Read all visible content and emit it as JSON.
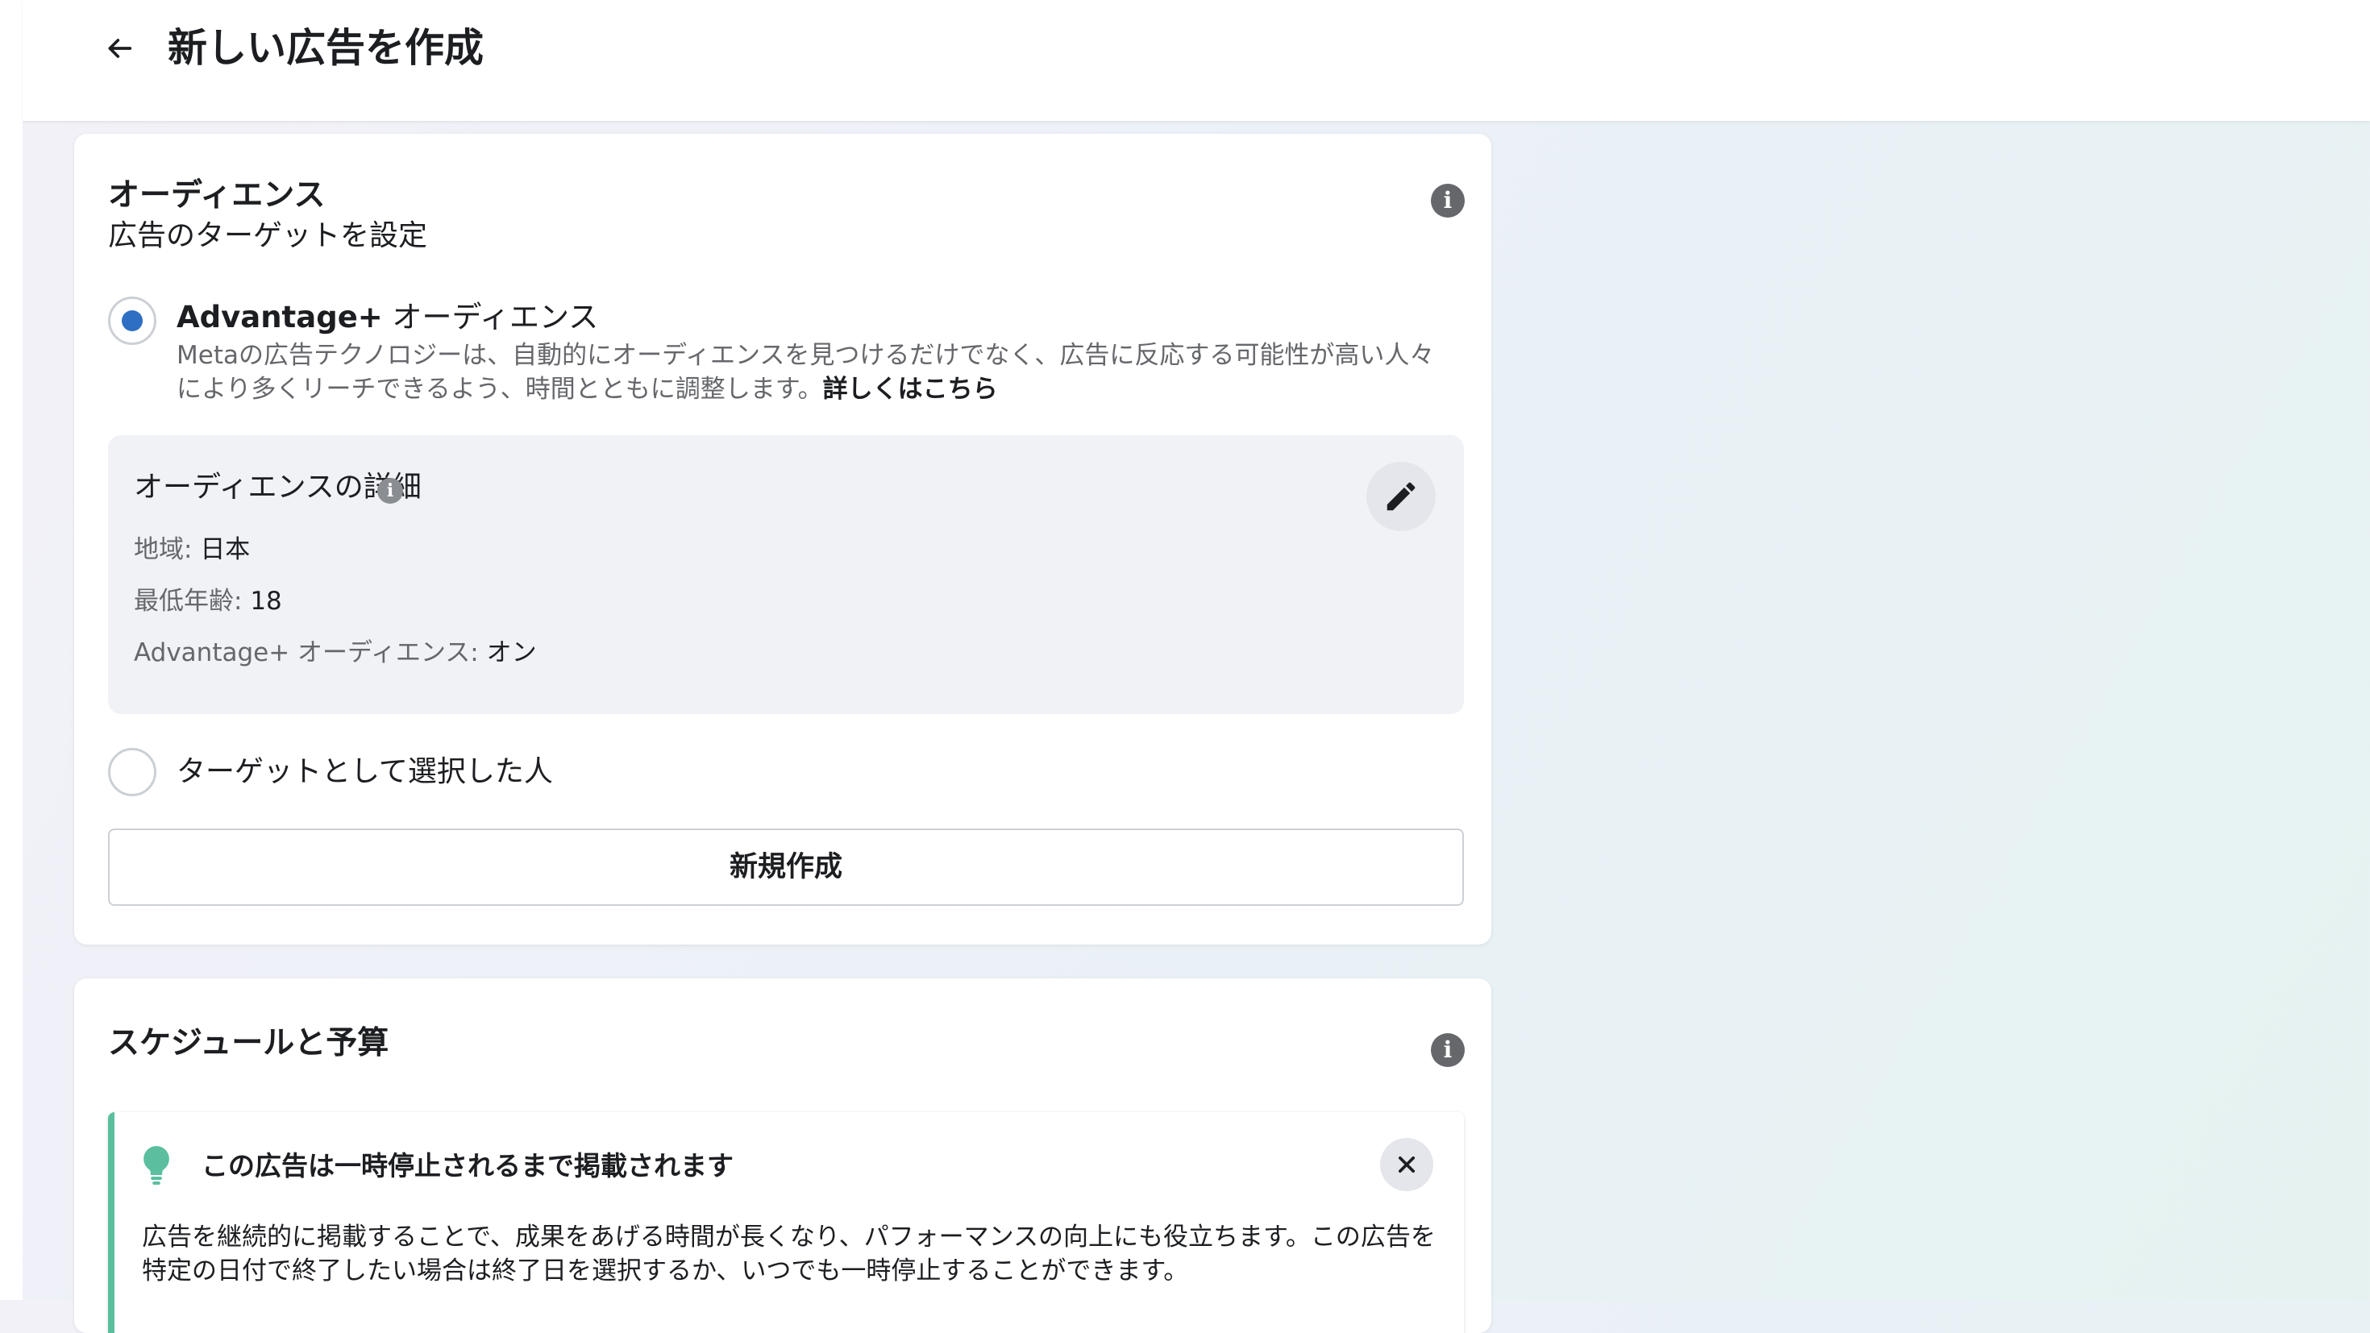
{
  "header": {
    "title": "新しい広告を作成",
    "back_icon": "arrow-left-icon"
  },
  "audience": {
    "title": "オーディエンス",
    "subtitle": "広告のターゲットを設定",
    "info_icon": "info-icon",
    "advantage_option": {
      "label_strong": "Advantage+",
      "label_rest": " オーディエンス",
      "selected": true,
      "description": "Metaの広告テクノロジーは、自動的にオーディエンスを見つけるだけでなく、広告に反応する可能性が高い人々により多くリーチできるよう、時間とともに調整します。",
      "learn_more": "詳しくはこちら"
    },
    "details": {
      "title": "オーディエンスの詳細",
      "edit_icon": "pencil-icon",
      "rows": [
        {
          "key": "地域: ",
          "value": "日本"
        },
        {
          "key": "最低年齢: ",
          "value": "18"
        },
        {
          "key": "Advantage+ オーディエンス: ",
          "value": "オン"
        }
      ]
    },
    "target_option": {
      "label": "ターゲットとして選択した人",
      "selected": false
    },
    "create_button": "新規作成"
  },
  "schedule": {
    "title": "スケジュールと予算",
    "info_icon": "info-icon",
    "tip": {
      "icon": "lightbulb-icon",
      "title": "この広告は一時停止されるまで掲載されます",
      "body": "広告を継続的に掲載することで、成果をあげる時間が長くなり、パフォーマンスの向上にも役立ちます。この広告を特定の日付で終了したい場合は終了日を選択するか、いつでも一時停止することができます。",
      "close_icon": "close-icon"
    }
  },
  "colors": {
    "accent_blue": "#2e6fc4",
    "tip_accent": "#5bbf9f"
  }
}
